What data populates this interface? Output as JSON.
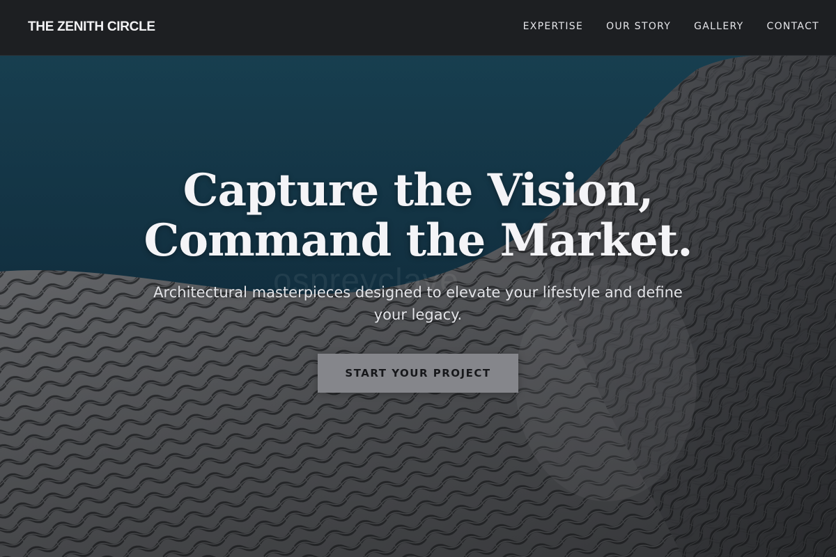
{
  "header": {
    "brand": "THE ZENITH CIRCLE",
    "nav": [
      {
        "label": "EXPERTISE"
      },
      {
        "label": "OUR STORY"
      },
      {
        "label": "GALLERY"
      },
      {
        "label": "CONTACT"
      }
    ]
  },
  "hero": {
    "title_line1": "Capture the Vision,",
    "title_line2": "Command the Market.",
    "subtitle_line1": "Architectural masterpieces designed to elevate your lifestyle and define",
    "subtitle_line2": "your legacy.",
    "cta_label": "START YOUR PROJECT",
    "watermark": "ospreyclave",
    "background": "architectural-mesh-facade-image"
  },
  "colors": {
    "header_bg": "#1d1f22",
    "sky": "#163e55",
    "cta_bg": "#85868b",
    "text": "#f4f4f7"
  }
}
